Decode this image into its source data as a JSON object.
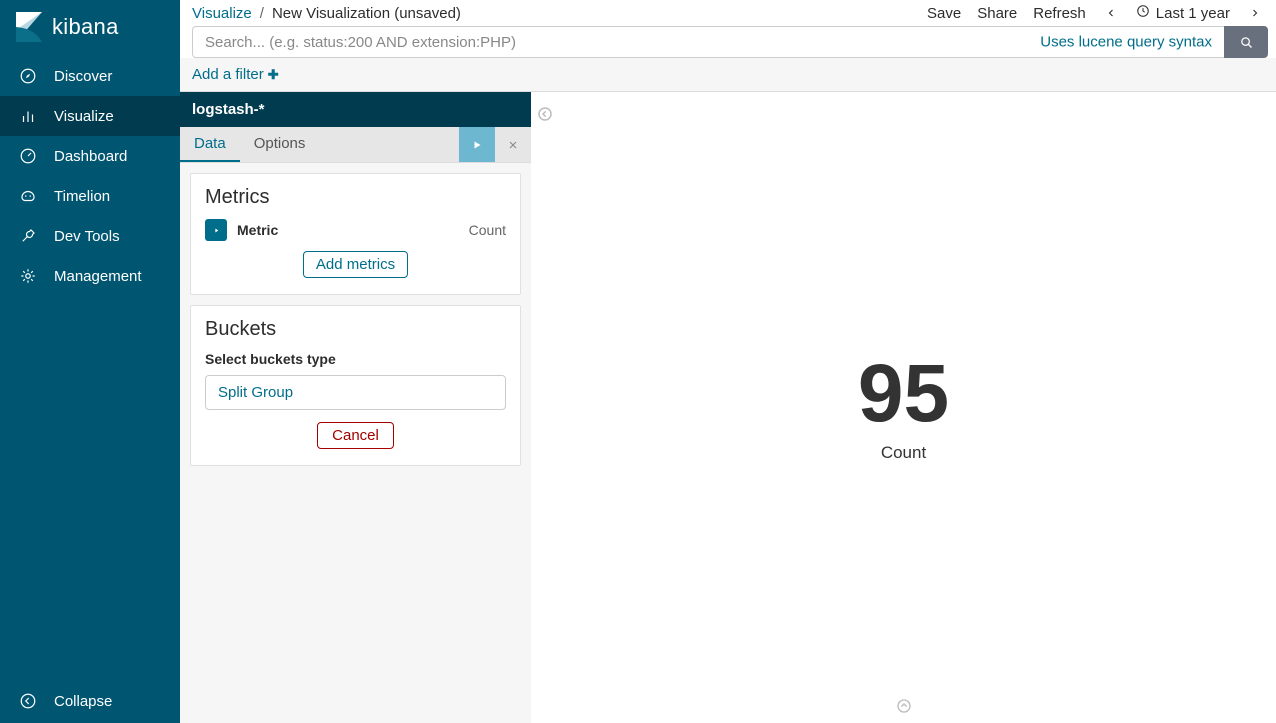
{
  "brand": "kibana",
  "nav": {
    "items": [
      {
        "label": "Discover"
      },
      {
        "label": "Visualize"
      },
      {
        "label": "Dashboard"
      },
      {
        "label": "Timelion"
      },
      {
        "label": "Dev Tools"
      },
      {
        "label": "Management"
      }
    ],
    "collapse": "Collapse"
  },
  "breadcrumb": {
    "root": "Visualize",
    "current": "New Visualization (unsaved)"
  },
  "topActions": {
    "save": "Save",
    "share": "Share",
    "refresh": "Refresh",
    "timeRange": "Last 1 year"
  },
  "search": {
    "placeholder": "Search... (e.g. status:200 AND extension:PHP)",
    "luceneHint": "Uses lucene query syntax"
  },
  "filterBar": {
    "addFilter": "Add a filter"
  },
  "indexPattern": "logstash-*",
  "tabs": {
    "data": "Data",
    "options": "Options"
  },
  "metricsCard": {
    "title": "Metrics",
    "rowLabel": "Metric",
    "rowValue": "Count",
    "addButton": "Add metrics"
  },
  "bucketsCard": {
    "title": "Buckets",
    "selectLabel": "Select buckets type",
    "option": "Split Group",
    "cancel": "Cancel"
  },
  "viz": {
    "value": "95",
    "label": "Count"
  }
}
